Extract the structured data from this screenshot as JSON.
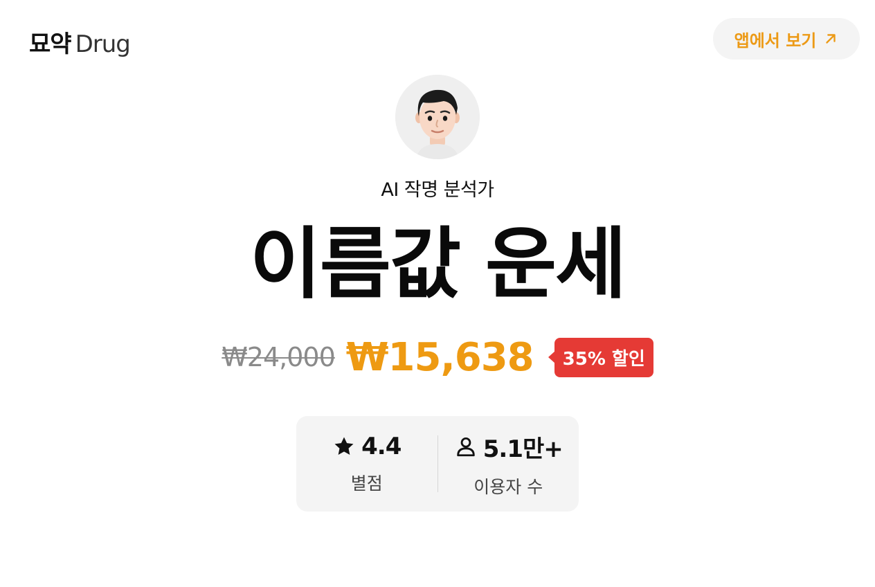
{
  "header": {
    "logo_kr": "묘약",
    "logo_en": "Drug",
    "app_button_label": "앱에서 보기"
  },
  "profile": {
    "avatar_icon": "avatar-memoji-icon",
    "subtitle": "AI 작명 분석가"
  },
  "title": "이름값 운세",
  "pricing": {
    "original_price": "₩24,000",
    "sale_price": "₩15,638",
    "discount_badge": "35% 할인",
    "colors": {
      "sale": "#ee9a12",
      "badge": "#e53a35",
      "accent": "#ec9a16"
    }
  },
  "stats": {
    "rating": {
      "icon": "star-icon",
      "value": "4.4",
      "label": "별점"
    },
    "users": {
      "icon": "person-icon",
      "value": "5.1만+",
      "label": "이용자 수"
    }
  }
}
